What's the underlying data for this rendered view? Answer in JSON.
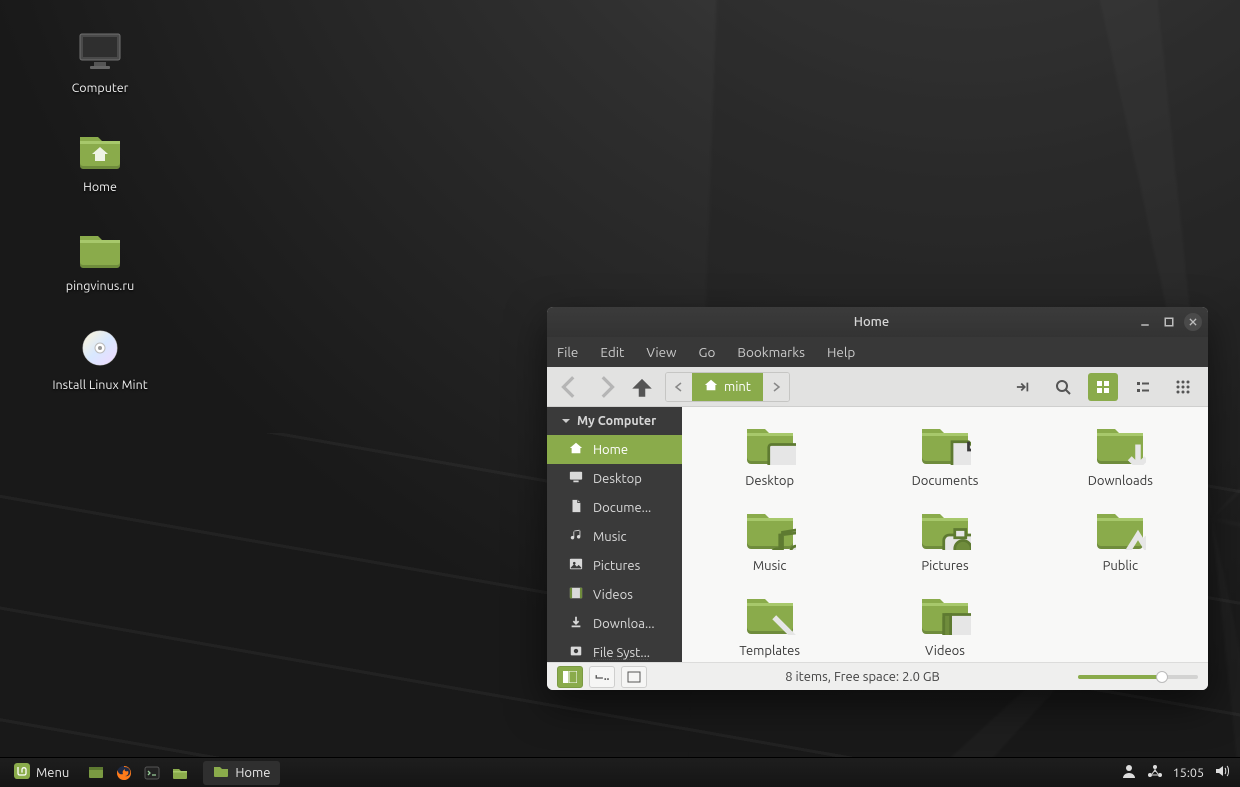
{
  "desktop": {
    "icons": [
      {
        "id": "computer",
        "label": "Computer",
        "kind": "monitor"
      },
      {
        "id": "home",
        "label": "Home",
        "kind": "folder-home"
      },
      {
        "id": "pingvinus",
        "label": "pingvinus.ru",
        "kind": "folder"
      },
      {
        "id": "install-mint",
        "label": "Install Linux Mint",
        "kind": "disc"
      }
    ]
  },
  "panel": {
    "menu_label": "Menu",
    "task_label": "Home",
    "clock": "15:05"
  },
  "window": {
    "title": "Home",
    "menubar": [
      "File",
      "Edit",
      "View",
      "Go",
      "Bookmarks",
      "Help"
    ],
    "path": {
      "current": "mint"
    },
    "sidebar": {
      "heading": "My Computer",
      "items": [
        {
          "label": "Home",
          "icon": "home",
          "active": true
        },
        {
          "label": "Desktop",
          "icon": "desktop",
          "active": false
        },
        {
          "label": "Docume...",
          "icon": "document",
          "active": false
        },
        {
          "label": "Music",
          "icon": "music",
          "active": false
        },
        {
          "label": "Pictures",
          "icon": "pictures",
          "active": false
        },
        {
          "label": "Videos",
          "icon": "videos",
          "active": false
        },
        {
          "label": "Downloa...",
          "icon": "download",
          "active": false
        },
        {
          "label": "File Syst...",
          "icon": "disk",
          "active": false,
          "under": true
        }
      ]
    },
    "folders": [
      {
        "label": "Desktop",
        "icon": "desktop"
      },
      {
        "label": "Documents",
        "icon": "document"
      },
      {
        "label": "Downloads",
        "icon": "download"
      },
      {
        "label": "Music",
        "icon": "music"
      },
      {
        "label": "Pictures",
        "icon": "pictures"
      },
      {
        "label": "Public",
        "icon": "public"
      },
      {
        "label": "Templates",
        "icon": "template"
      },
      {
        "label": "Videos",
        "icon": "videos"
      }
    ],
    "status": "8 items, Free space: 2.0 GB"
  },
  "colors": {
    "accent": "#8aab4b"
  }
}
